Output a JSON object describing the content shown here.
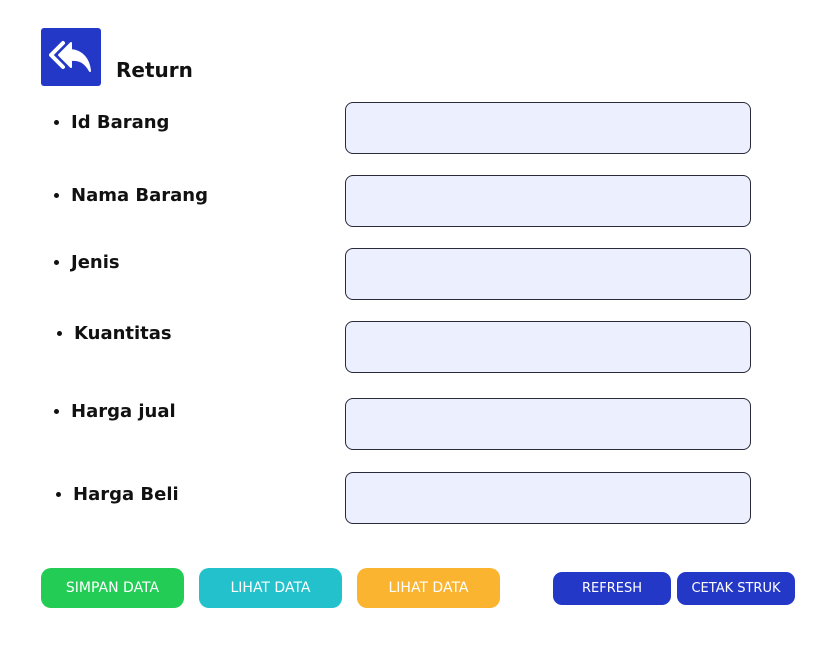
{
  "header": {
    "title": "Return",
    "back_icon": "double-reply-arrow-icon"
  },
  "form": {
    "fields": [
      {
        "label": "Id Barang",
        "value": ""
      },
      {
        "label": "Nama Barang",
        "value": ""
      },
      {
        "label": "Jenis",
        "value": ""
      },
      {
        "label": "Kuantitas",
        "value": ""
      },
      {
        "label": "Harga jual",
        "value": ""
      },
      {
        "label": "Harga Beli",
        "value": ""
      }
    ]
  },
  "actions": {
    "simpan_label": "SIMPAN DATA",
    "lihat_label_1": "LIHAT DATA",
    "lihat_label_2": "LIHAT DATA",
    "refresh_label": "REFRESH",
    "cetak_label": "CETAK STRUK"
  },
  "colors": {
    "primary": "#2438c8",
    "success": "#22cc55",
    "info": "#22c1cc",
    "warning": "#fbb430",
    "input_bg": "#eceffd"
  }
}
